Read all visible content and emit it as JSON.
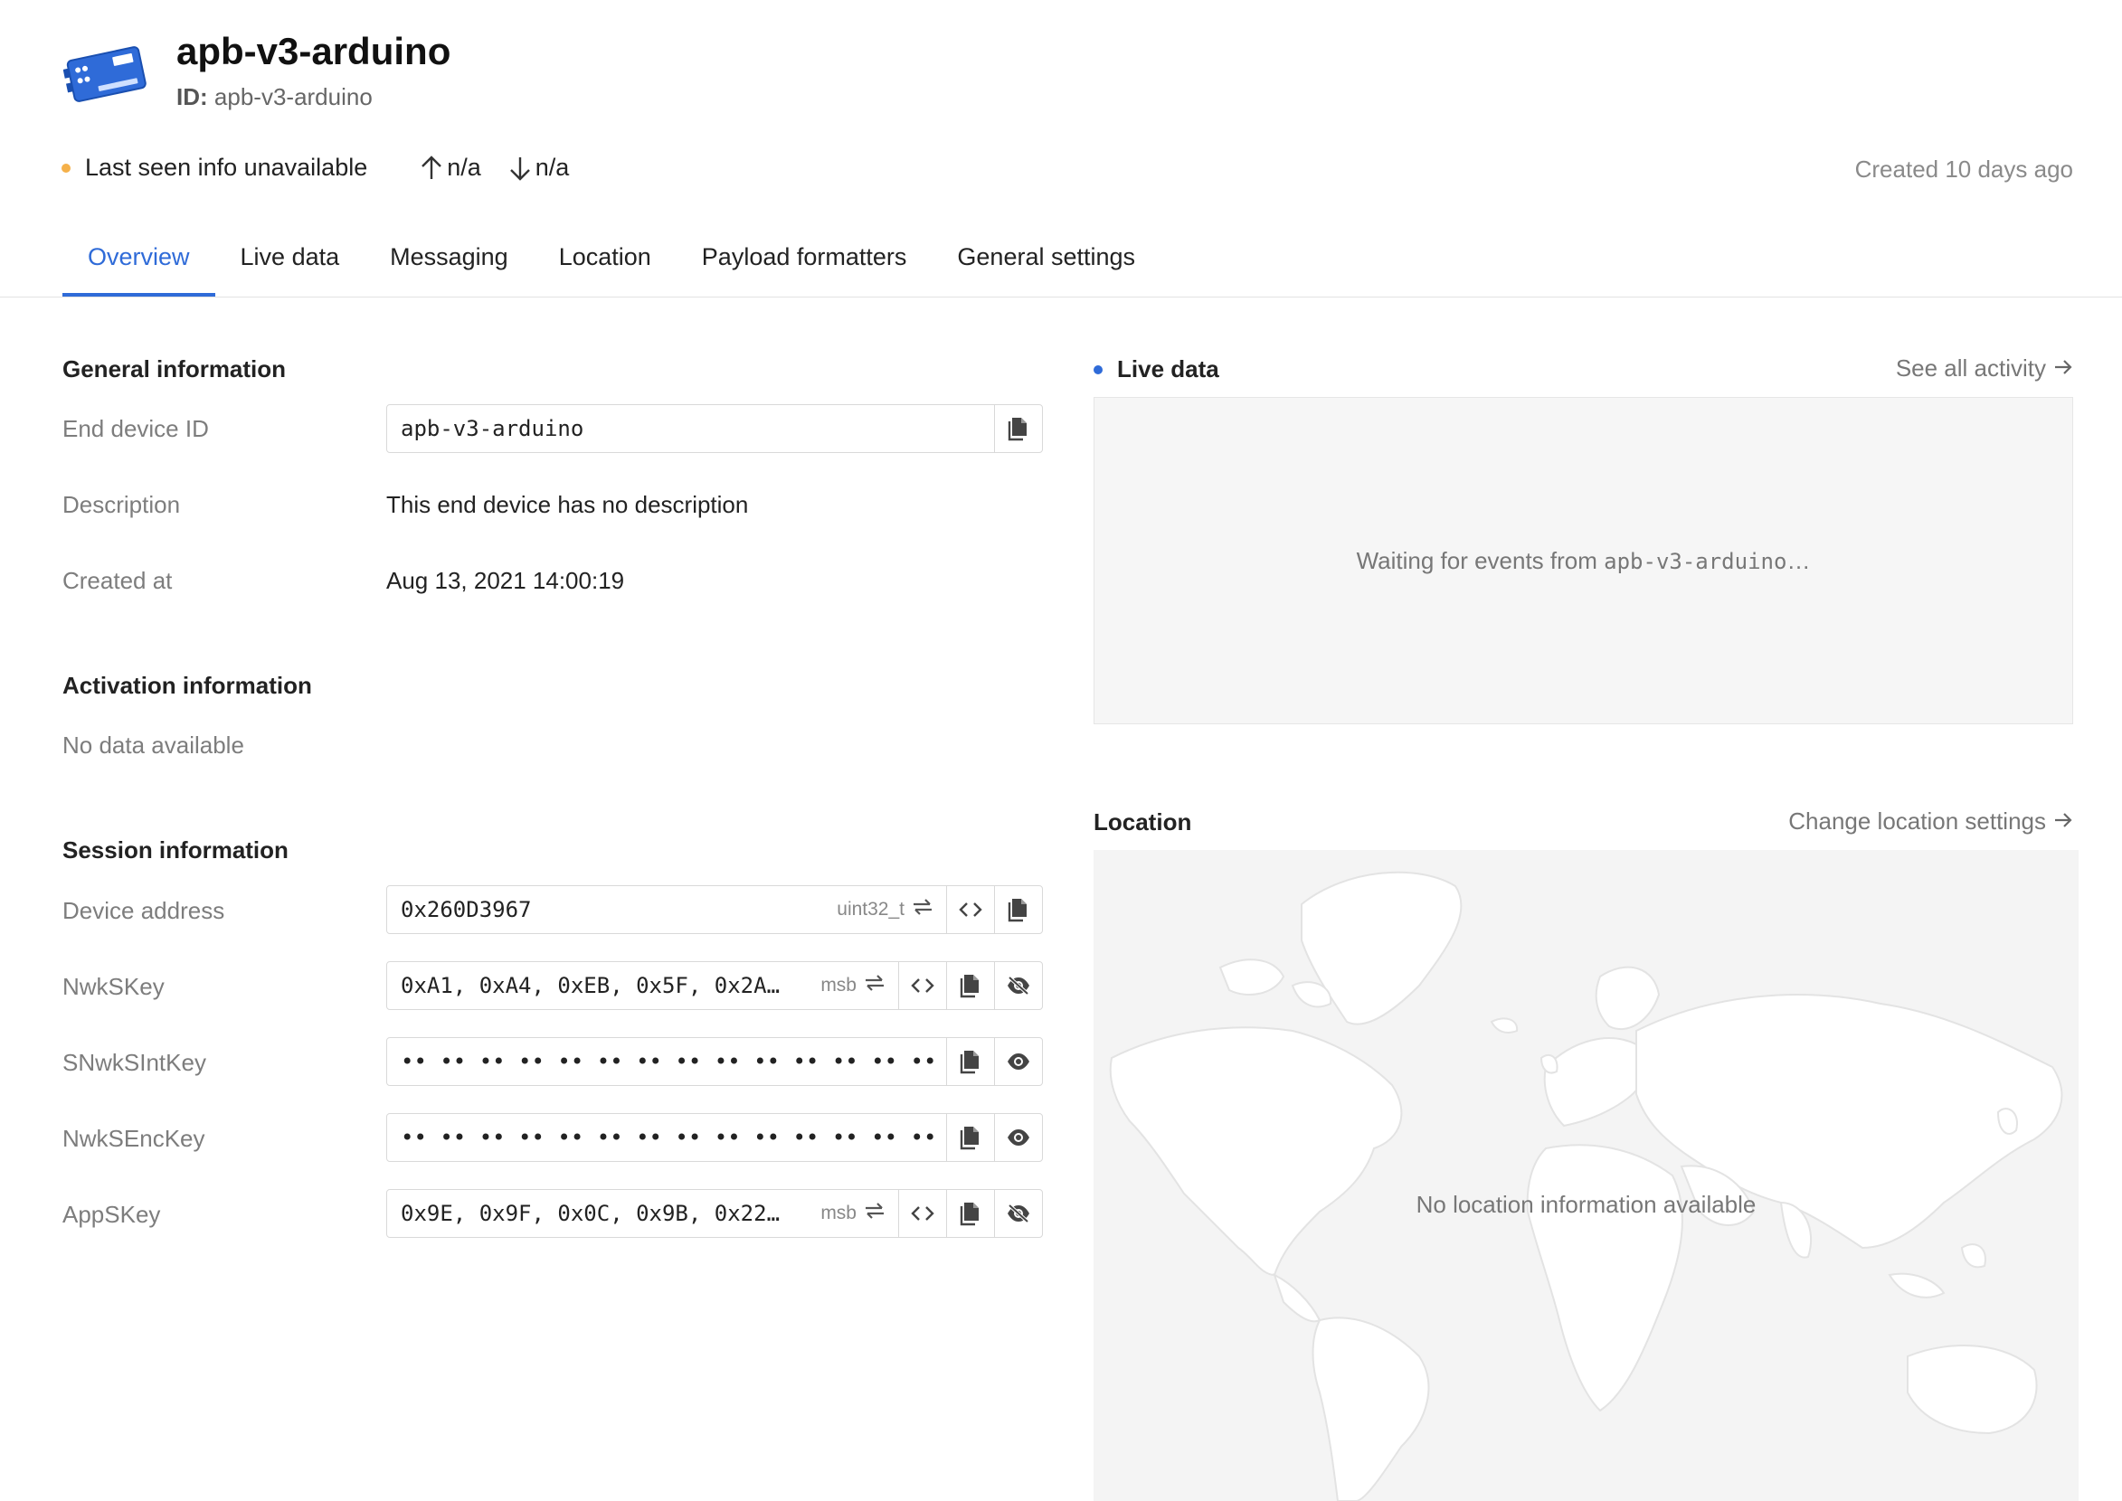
{
  "header": {
    "title": "apb-v3-arduino",
    "id_label": "ID:",
    "id_value": "apb-v3-arduino",
    "status_text": "Last seen info unavailable",
    "status_color": "#f5b14a",
    "uplink": "n/a",
    "downlink": "n/a",
    "created": "Created 10 days ago"
  },
  "tabs": [
    {
      "label": "Overview",
      "active": true
    },
    {
      "label": "Live data"
    },
    {
      "label": "Messaging"
    },
    {
      "label": "Location"
    },
    {
      "label": "Payload formatters"
    },
    {
      "label": "General settings"
    }
  ],
  "general": {
    "title": "General information",
    "end_device_id_label": "End device ID",
    "end_device_id_value": "apb-v3-arduino",
    "description_label": "Description",
    "description_value": "This end device has no description",
    "created_label": "Created at",
    "created_value": "Aug 13, 2021 14:00:19"
  },
  "activation": {
    "title": "Activation information",
    "empty": "No data available"
  },
  "session": {
    "title": "Session information",
    "rows": [
      {
        "label": "Device address",
        "value": "0x260D3967",
        "type": "uint32_t"
      },
      {
        "label": "NwkSKey",
        "value": "0xA1, 0xA4, 0xEB, 0x5F, 0x2A…",
        "type": "msb"
      },
      {
        "label": "SNwkSIntKey",
        "value": "•• •• •• •• •• •• •• •• •• •• •• •• •• •• •• ••"
      },
      {
        "label": "NwkSEncKey",
        "value": "•• •• •• •• •• •• •• •• •• •• •• •• •• •• •• ••"
      },
      {
        "label": "AppSKey",
        "value": "0x9E, 0x9F, 0x0C, 0x9B, 0x22…",
        "type": "msb"
      }
    ]
  },
  "live": {
    "title": "Live data",
    "dot_color": "#2f6bd8",
    "see_all": "See all activity",
    "waiting_prefix": "Waiting for events from ",
    "waiting_device": "apb-v3-arduino",
    "waiting_suffix": "…"
  },
  "location": {
    "title": "Location",
    "change": "Change location settings",
    "empty": "No location information available"
  },
  "icons": {
    "device": "device-board-icon",
    "copy": "copy-icon",
    "code": "code-icon",
    "swap": "swap-icon",
    "eye": "eye-icon",
    "eye_off": "eye-off-icon",
    "arrow_up": "arrow-up-icon",
    "arrow_down": "arrow-down-icon",
    "arrow_right": "arrow-right-icon"
  },
  "colors": {
    "accent": "#2f6bd8",
    "muted": "#7d7d7d"
  }
}
